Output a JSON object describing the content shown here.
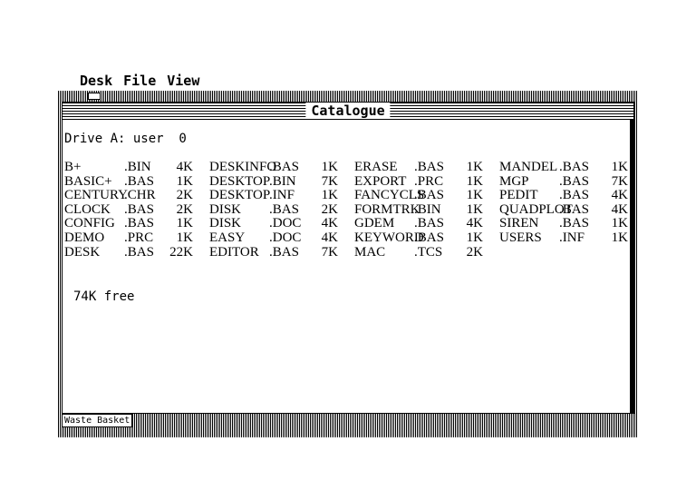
{
  "menubar": {
    "items": [
      "Desk",
      "File",
      "View"
    ]
  },
  "window": {
    "title": "Catalogue",
    "drive_line": "Drive A: user  0",
    "free_text": "74K free"
  },
  "files": [
    [
      {
        "name": "B+",
        "ext": ".BIN",
        "size": "4K"
      },
      {
        "name": "BASIC+",
        "ext": ".BAS",
        "size": "1K"
      },
      {
        "name": "CENTURY",
        "ext": ".CHR",
        "size": "2K"
      },
      {
        "name": "CLOCK",
        "ext": ".BAS",
        "size": "2K"
      },
      {
        "name": "CONFIG",
        "ext": ".BAS",
        "size": "1K"
      },
      {
        "name": "DEMO",
        "ext": ".PRC",
        "size": "1K"
      },
      {
        "name": "DESK",
        "ext": ".BAS",
        "size": "22K"
      }
    ],
    [
      {
        "name": "DESKINFO",
        "ext": ".BAS",
        "size": "1K"
      },
      {
        "name": "DESKTOP",
        "ext": ".BIN",
        "size": "7K"
      },
      {
        "name": "DESKTOP",
        "ext": ".INF",
        "size": "1K"
      },
      {
        "name": "DISK",
        "ext": ".BAS",
        "size": "2K"
      },
      {
        "name": "DISK",
        "ext": ".DOC",
        "size": "4K"
      },
      {
        "name": "EASY",
        "ext": ".DOC",
        "size": "4K"
      },
      {
        "name": "EDITOR",
        "ext": ".BAS",
        "size": "7K"
      }
    ],
    [
      {
        "name": "ERASE",
        "ext": ".BAS",
        "size": "1K"
      },
      {
        "name": "EXPORT",
        "ext": ".PRC",
        "size": "1K"
      },
      {
        "name": "FANCYCLS",
        "ext": ".BAS",
        "size": "1K"
      },
      {
        "name": "FORMTRK",
        "ext": ".BIN",
        "size": "1K"
      },
      {
        "name": "GDEM",
        "ext": ".BAS",
        "size": "4K"
      },
      {
        "name": "KEYWORD",
        "ext": ".BAS",
        "size": "1K"
      },
      {
        "name": "MAC",
        "ext": ".TCS",
        "size": "2K"
      }
    ],
    [
      {
        "name": "MANDEL",
        "ext": ".BAS",
        "size": "1K"
      },
      {
        "name": "MGP",
        "ext": ".BAS",
        "size": "7K"
      },
      {
        "name": "PEDIT",
        "ext": ".BAS",
        "size": "4K"
      },
      {
        "name": "QUADPLOT",
        "ext": ".BAS",
        "size": "4K"
      },
      {
        "name": "SIREN",
        "ext": ".BAS",
        "size": "1K"
      },
      {
        "name": "USERS",
        "ext": ".INF",
        "size": "1K"
      }
    ]
  ],
  "waste_basket": {
    "label": "Waste Basket"
  }
}
